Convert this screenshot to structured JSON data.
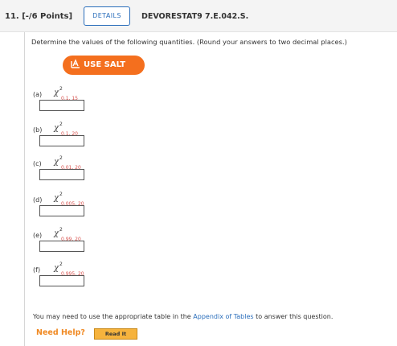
{
  "header": {
    "question_number": "11. [-/6 Points]",
    "details_label": "DETAILS",
    "question_id": "DEVORESTAT9 7.E.042.S."
  },
  "main": {
    "instruction": "Determine the values of the following quantities. (Round your answers to two decimal places.)",
    "salt_button": "USE SALT",
    "items": [
      {
        "label": "(a)",
        "sub": "0.1, 15",
        "value": ""
      },
      {
        "label": "(b)",
        "sub": "0.1, 20",
        "value": ""
      },
      {
        "label": "(c)",
        "sub": "0.01, 20",
        "value": ""
      },
      {
        "label": "(d)",
        "sub": "0.005, 20",
        "value": ""
      },
      {
        "label": "(e)",
        "sub": "0.99, 20",
        "value": ""
      },
      {
        "label": "(f)",
        "sub": "0.995, 20",
        "value": ""
      }
    ],
    "chi_symbol": "χ",
    "chi_power": "2",
    "footer_before": "You may need to use the appropriate table in the ",
    "footer_link": "Appendix of Tables",
    "footer_after": " to answer this question.",
    "need_help": "Need Help?",
    "read_it": "Read It"
  },
  "colors": {
    "salt": "#f46f1e",
    "link": "#2a6ebb",
    "subscript": "#d9534f",
    "need_help": "#f08a24"
  }
}
